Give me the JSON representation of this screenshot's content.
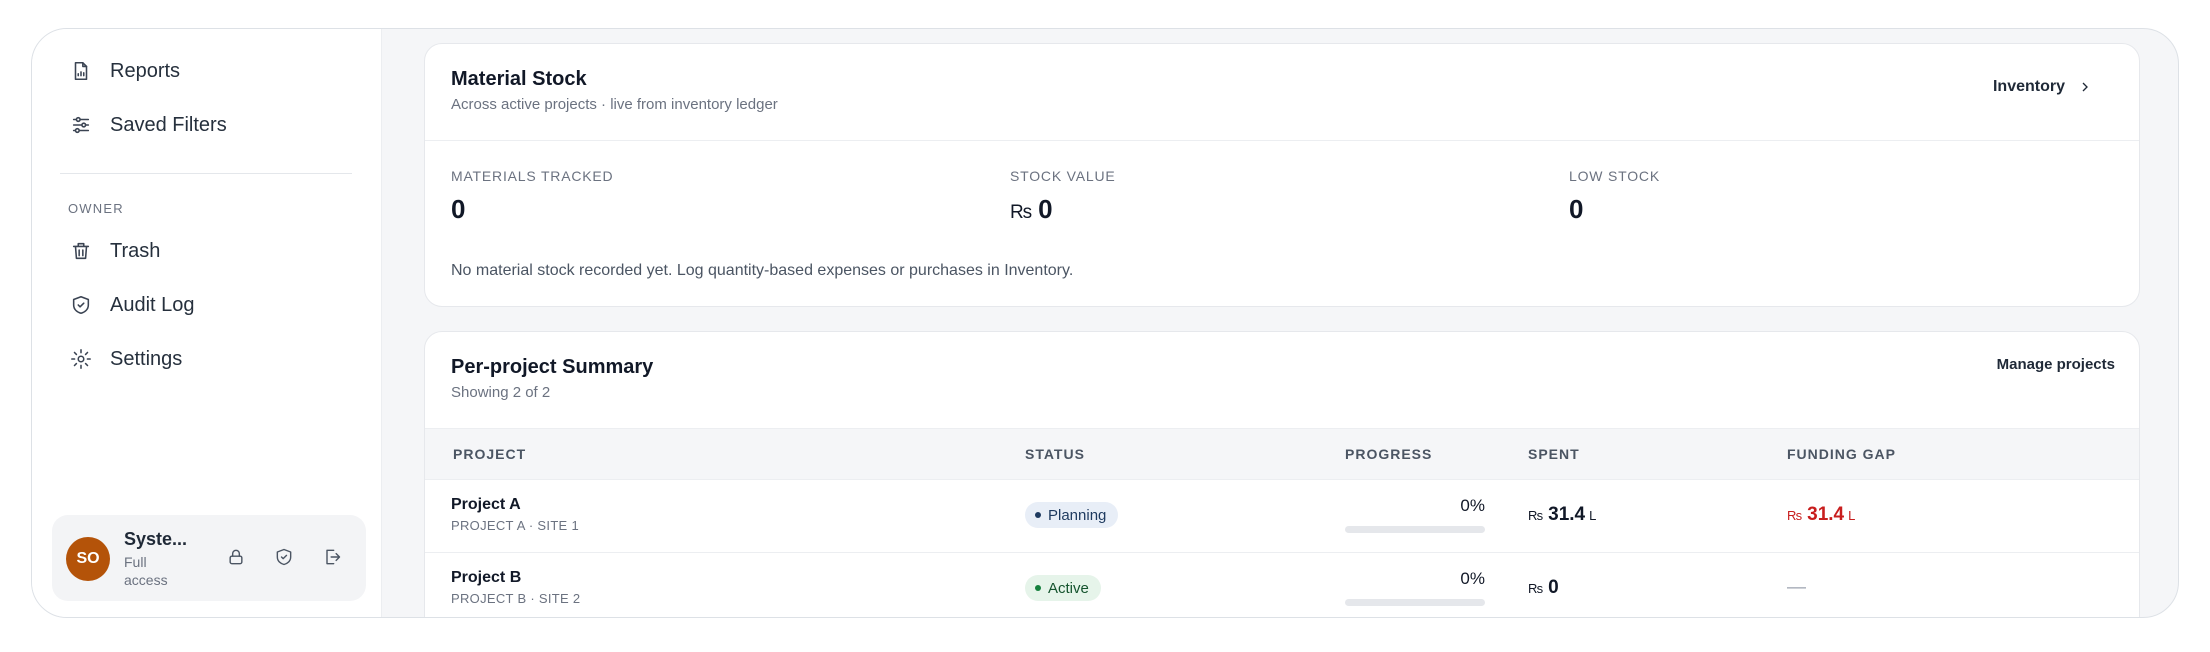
{
  "sidebar": {
    "items": [
      {
        "label": "Reports",
        "icon": "report-icon"
      },
      {
        "label": "Saved Filters",
        "icon": "filters-icon"
      }
    ],
    "owner_section_label": "OWNER",
    "owner_items": [
      {
        "label": "Trash",
        "icon": "trash-icon"
      },
      {
        "label": "Audit Log",
        "icon": "shield-check-icon"
      },
      {
        "label": "Settings",
        "icon": "sun-gear-icon"
      }
    ],
    "user": {
      "initials": "SO",
      "name": "Syste...",
      "role": "Full access",
      "avatar_color": "#b45309",
      "actions": [
        "lock-icon",
        "shield-icon",
        "logout-icon"
      ]
    }
  },
  "material_stock": {
    "title": "Material Stock",
    "subtitle": "Across active projects · live from inventory ledger",
    "link_label": "Inventory",
    "stats": [
      {
        "label": "MATERIALS TRACKED",
        "value": "0",
        "currency": ""
      },
      {
        "label": "STOCK VALUE",
        "value": "0",
        "currency": "₨"
      },
      {
        "label": "LOW STOCK",
        "value": "0",
        "currency": ""
      }
    ],
    "empty_note": "No material stock recorded yet. Log quantity-based expenses or purchases in Inventory."
  },
  "project_summary": {
    "title": "Per-project Summary",
    "subtitle": "Showing 2 of 2",
    "link_label": "Manage projects",
    "columns": [
      "PROJECT",
      "STATUS",
      "PROGRESS",
      "SPENT",
      "FUNDING GAP"
    ],
    "rows": [
      {
        "name": "Project A",
        "site": "PROJECT A · SITE 1",
        "status": "Planning",
        "progress_label": "0%",
        "progress": 0,
        "spent_currency": "₨",
        "spent": "31.4",
        "spent_unit": "L",
        "gap_currency": "₨",
        "gap": "31.4",
        "gap_unit": "L"
      },
      {
        "name": "Project B",
        "site": "PROJECT B · SITE 2",
        "status": "Active",
        "progress_label": "0%",
        "progress": 0,
        "spent_currency": "₨",
        "spent": "0",
        "spent_unit": "",
        "gap_text": "—"
      }
    ]
  },
  "colors": {
    "accent_brown": "#b45309",
    "gap_red": "#c81e1e",
    "planning_badge": "#e8eef7",
    "active_badge": "#e6f4ea"
  }
}
